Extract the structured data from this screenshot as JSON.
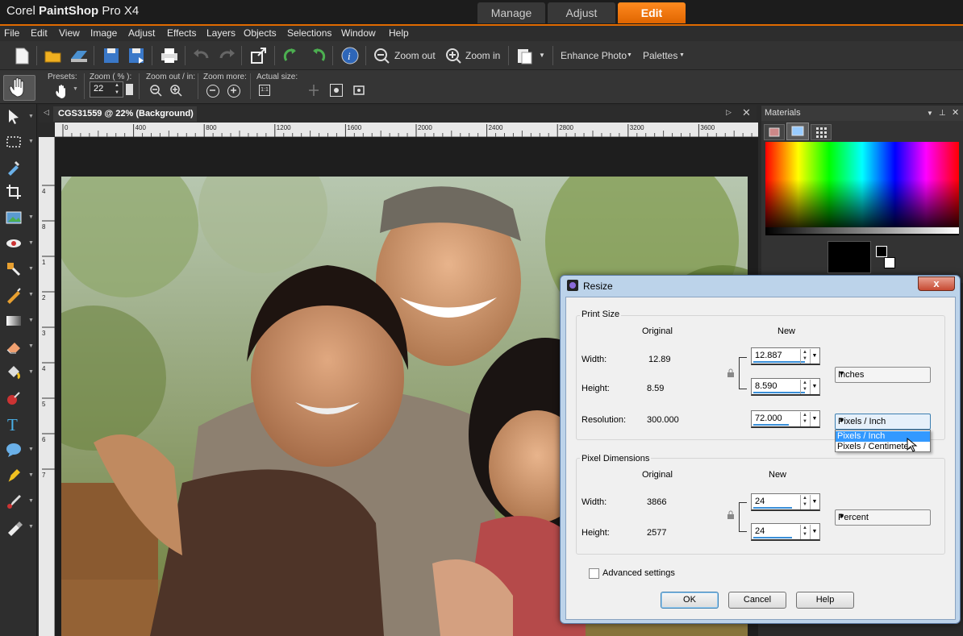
{
  "app": {
    "title_prefix": "Corel ",
    "title_bold": "PaintShop",
    "title_suffix": " Pro X4"
  },
  "workspace_tabs": [
    {
      "label": "Manage"
    },
    {
      "label": "Adjust"
    },
    {
      "label": "Edit",
      "active": true
    }
  ],
  "menu": [
    "File",
    "Edit",
    "View",
    "Image",
    "Adjust",
    "Effects",
    "Layers",
    "Objects",
    "Selections",
    "Window",
    "Help"
  ],
  "toolbar": {
    "zoom_out": "Zoom out",
    "zoom_in": "Zoom in",
    "enhance": "Enhance Photo",
    "palettes": "Palettes"
  },
  "options": {
    "presets": "Presets:",
    "zoom_pct_label": "Zoom ( % ):",
    "zoom_value": "22",
    "zoom_out_in": "Zoom out / in:",
    "zoom_more": "Zoom more:",
    "actual_size": "Actual size:"
  },
  "document": {
    "tab_title": "CGS31559 @  22% (Background)",
    "ruler_ticks": [
      "0",
      "400",
      "800",
      "1200",
      "1600",
      "2000",
      "2400",
      "2800",
      "3200",
      "3600"
    ],
    "vruler_ticks": [
      "4",
      "8",
      "1",
      "2",
      "3",
      "4",
      "5",
      "6",
      "7"
    ]
  },
  "materials": {
    "title": "Materials"
  },
  "dialog": {
    "title": "Resize",
    "close": "x",
    "print_size": {
      "label": "Print Size",
      "col_original": "Original",
      "col_new": "New",
      "width_label": "Width:",
      "width_orig": "12.89",
      "width_new": "12.887",
      "height_label": "Height:",
      "height_orig": "8.59",
      "height_new": "8.590",
      "res_label": "Resolution:",
      "res_orig": "300.000",
      "res_new": "72.000",
      "units": "Inches",
      "res_units": "Pixels / Inch",
      "res_options": [
        "Pixels / Inch",
        "Pixels / Centimeter"
      ]
    },
    "pixel_dimensions": {
      "label": "Pixel Dimensions",
      "col_original": "Original",
      "col_new": "New",
      "width_label": "Width:",
      "width_orig": "3866",
      "width_new": "24",
      "height_label": "Height:",
      "height_orig": "2577",
      "height_new": "24",
      "units": "Percent"
    },
    "advanced": "Advanced settings",
    "ok": "OK",
    "cancel": "Cancel",
    "help": "Help"
  },
  "colors": {
    "accent": "#e06a00",
    "dialog_frame": "#bcd3ea",
    "selection": "#3399ff"
  }
}
